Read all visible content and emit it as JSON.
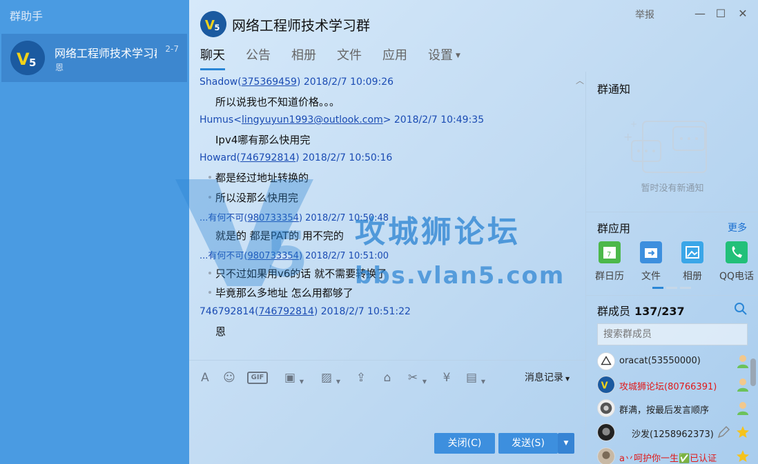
{
  "left_panel": {
    "title": "群助手",
    "conversation": {
      "name": "网络工程师技术学习群",
      "date": "2-7",
      "preview": "恩"
    }
  },
  "header": {
    "group_name": "网络工程师技术学习群",
    "report": "举报",
    "tabs": [
      "聊天",
      "公告",
      "相册",
      "文件",
      "应用",
      "设置"
    ]
  },
  "messages": [
    {
      "sender": "Shadow",
      "id": "375369459",
      "time": "2018/2/7 10:09:26",
      "lines": [
        "所以说我也不知道价格。。。"
      ],
      "bullets": false
    },
    {
      "sender": "Humus<",
      "id": "lingyuyun1993@outlook.com",
      "id_suffix": ">",
      "time": "2018/2/7 10:49:35",
      "lines": [
        "Ipv4哪有那么快用完"
      ],
      "bullets": false
    },
    {
      "sender": "Howard",
      "id": "746792814",
      "time": "2018/2/7 10:50:16",
      "lines": [
        "都是经过地址转换的",
        "所以没那么快用完"
      ],
      "bullets": true
    },
    {
      "sender": "...有何不可",
      "id": "980733354",
      "time": "2018/2/7 10:50:48",
      "lines": [
        "就是的  都是PAT的   用不完的"
      ],
      "bullets": false
    },
    {
      "sender": "...有何不可",
      "id": "980733354",
      "time": "2018/2/7 10:51:00",
      "lines": [
        "只不过如果用v6的话  就不需要转换了",
        "毕竟那么多地址   怎么用都够了"
      ],
      "bullets": true
    },
    {
      "sender": "746792814",
      "id": "746792814",
      "time": "2018/2/7 10:51:22",
      "lines": [
        "恩"
      ],
      "bullets": false
    }
  ],
  "watermark": {
    "text": "攻城狮论坛",
    "url": "bbs.vlan5.com"
  },
  "toolbar": {
    "icons": [
      "font-icon",
      "emoji-icon",
      "gif-icon",
      "screenshot-icon",
      "image-icon",
      "upload-icon",
      "gift-icon",
      "scissors-icon",
      "red-packet-icon",
      "remote-icon"
    ],
    "history_label": "消息记录"
  },
  "buttons": {
    "close": "关闭(C)",
    "send": "发送(S)"
  },
  "right_panel": {
    "notice_title": "群通知",
    "notice_empty": "暂时没有新通知",
    "apps_title": "群应用",
    "more": "更多",
    "apps": [
      {
        "label": "群日历",
        "color": "#4cb84a"
      },
      {
        "label": "文件",
        "color": "#3d8fde"
      },
      {
        "label": "相册",
        "color": "#3aa6e8"
      },
      {
        "label": "QQ电话",
        "color": "#22c079"
      }
    ],
    "members_title": "群成员",
    "members_count": "137/237",
    "member_search_placeholder": "搜索群成员",
    "members": [
      {
        "name": "oracat(53550000)",
        "red": false,
        "role": "member"
      },
      {
        "name": "攻城狮论坛(80766391)",
        "red": true,
        "role": "member"
      },
      {
        "name": "群满，按最后发言顺序",
        "red": false,
        "role": "member"
      },
      {
        "name": "沙发(1258962373)",
        "red": false,
        "role": "admin"
      },
      {
        "name": "a丷呵护你一生✅已认证",
        "red": true,
        "role": "admin"
      }
    ]
  },
  "colors": {
    "accent": "#2a86d6",
    "link": "#1a4bb3",
    "button": "#3d8fde",
    "red_name": "#e01a1a"
  }
}
